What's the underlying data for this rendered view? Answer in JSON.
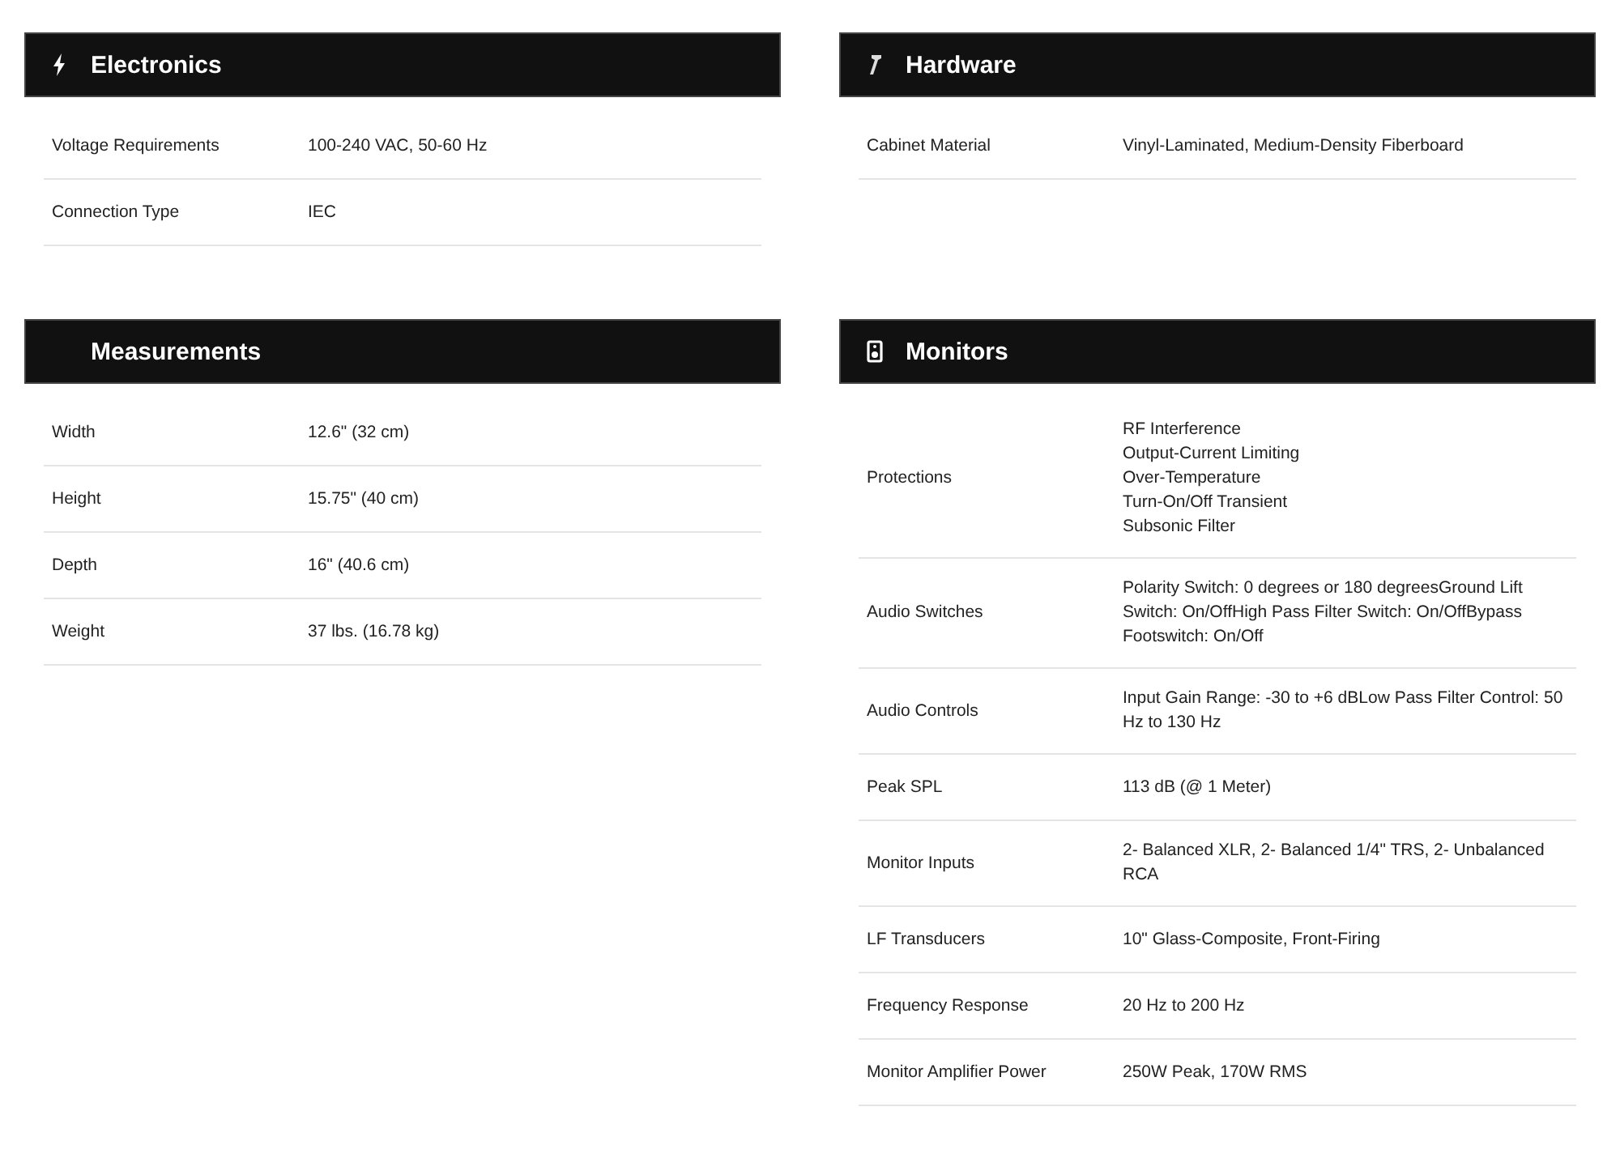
{
  "sections": [
    {
      "title": "Electronics",
      "rows": [
        {
          "label": "Voltage Requirements",
          "value": "100-240 VAC, 50-60 Hz"
        },
        {
          "label": "Connection Type",
          "value": "IEC"
        }
      ]
    },
    {
      "title": "Hardware",
      "rows": [
        {
          "label": "Cabinet Material",
          "value": "Vinyl-Laminated, Medium-Density Fiberboard"
        }
      ]
    },
    {
      "title": "Measurements",
      "rows": [
        {
          "label": "Width",
          "value": "12.6\" (32 cm)"
        },
        {
          "label": "Height",
          "value": "15.75\" (40 cm)"
        },
        {
          "label": "Depth",
          "value": "16\" (40.6 cm)"
        },
        {
          "label": "Weight",
          "value": "37 lbs. (16.78 kg)"
        }
      ]
    },
    {
      "title": "Monitors",
      "rows": [
        {
          "label": "Protections",
          "value_lines": [
            "RF Interference",
            "Output-Current Limiting",
            "Over-Temperature",
            "Turn-On/Off Transient",
            "Subsonic Filter"
          ]
        },
        {
          "label": "Audio Switches",
          "value": "Polarity Switch: 0 degrees or 180 degreesGround Lift Switch: On/OffHigh Pass Filter Switch: On/OffBypass Footswitch: On/Off"
        },
        {
          "label": "Audio Controls",
          "value": "Input Gain Range: -30 to +6 dBLow Pass Filter Control: 50 Hz to 130 Hz"
        },
        {
          "label": "Peak SPL",
          "value": "113 dB (@ 1 Meter)"
        },
        {
          "label": "Monitor Inputs",
          "value": "2- Balanced XLR, 2- Balanced 1/4\" TRS, 2- Unbalanced RCA"
        },
        {
          "label": "LF Transducers",
          "value": "10\" Glass-Composite, Front-Firing"
        },
        {
          "label": "Frequency Response",
          "value": "20 Hz to 200 Hz"
        },
        {
          "label": "Monitor Amplifier Power",
          "value": "250W Peak, 170W RMS"
        }
      ]
    }
  ]
}
